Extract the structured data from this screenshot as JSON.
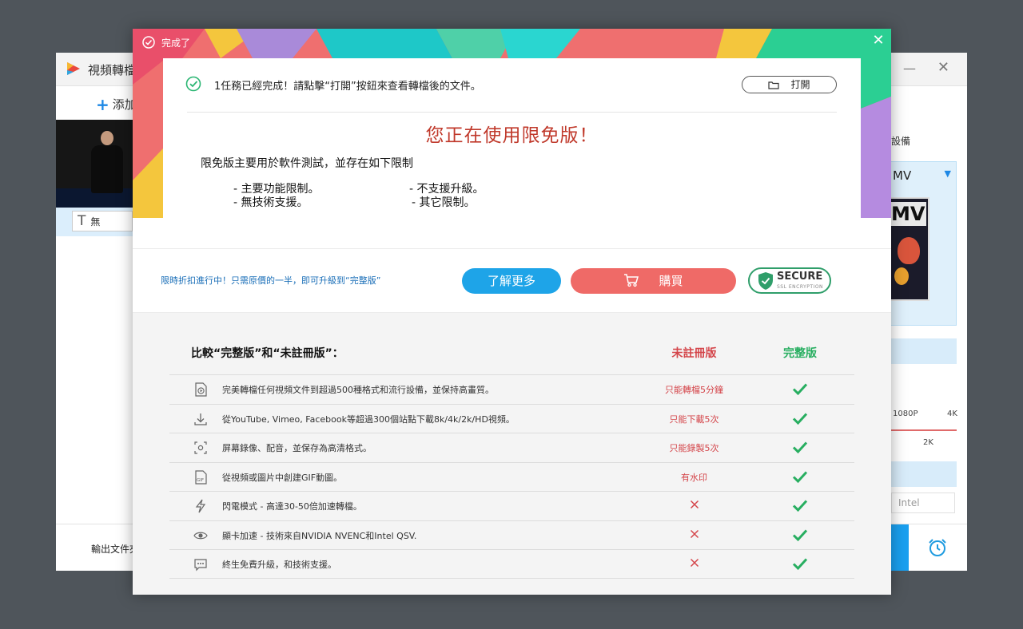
{
  "background_app": {
    "title": "視頻轉檔",
    "add_label": "添加",
    "subtitle_value": "無",
    "output_label": "輸出文件夾",
    "device_label": "設備",
    "format_name": "MV",
    "format_badge": "MV",
    "res_1080": "1080P",
    "res_4k": "4K",
    "res_2k": "2K",
    "intel_label": "Intel"
  },
  "modal": {
    "header_title": "完成了",
    "done_message": "1任務已經完成！請點擊“打開”按鈕來查看轉檔後的文件。",
    "open_button": "打開",
    "limited_title": "您正在使用限免版！",
    "limited_desc": "限免版主要用於軟件測試，並存在如下限制",
    "limits": [
      "- 主要功能限制。",
      "- 無技術支援。",
      "- 不支援升級。",
      "- 其它限制。"
    ],
    "promo_text": "限時折扣進行中！只需原價的一半，即可升級到“完整版”",
    "learn_more": "了解更多",
    "buy": "購買",
    "secure_title": "SECURE",
    "secure_sub": "SSL ENCRYPTION",
    "compare_title": "比較“完整版”和“未註冊版”：",
    "col_free": "未註冊版",
    "col_full": "完整版",
    "rows": [
      {
        "icon": "video-file-icon",
        "text": "完美轉檔任何視頻文件到超過500種格式和流行設備，並保持高畫質。",
        "free": "只能轉檔5分鐘",
        "full": "check"
      },
      {
        "icon": "download-icon",
        "text": "從YouTube, Vimeo, Facebook等超過300個站點下載8k/4k/2k/HD視頻。",
        "free": "只能下載5次",
        "full": "check"
      },
      {
        "icon": "screen-record-icon",
        "text": "屏幕錄像、配音，並保存為高清格式。",
        "free": "只能錄製5次",
        "full": "check"
      },
      {
        "icon": "gif-icon",
        "text": "從視頻或圖片中創建GIF動圖。",
        "free": "有水印",
        "full": "check"
      },
      {
        "icon": "lightning-icon",
        "text": "閃電模式 - 高達30-50倍加速轉檔。",
        "free": "cross",
        "full": "check"
      },
      {
        "icon": "gpu-eye-icon",
        "text": "顯卡加速 - 技術來自NVIDIA NVENC和Intel QSV.",
        "free": "cross",
        "full": "check"
      },
      {
        "icon": "chat-support-icon",
        "text": "終生免費升級，和技術支援。",
        "free": "cross",
        "full": "check"
      }
    ]
  },
  "colors": {
    "red": "#d4454a",
    "green": "#27ae60",
    "blue": "#1ea4e8",
    "buy_red": "#ef6a67"
  }
}
